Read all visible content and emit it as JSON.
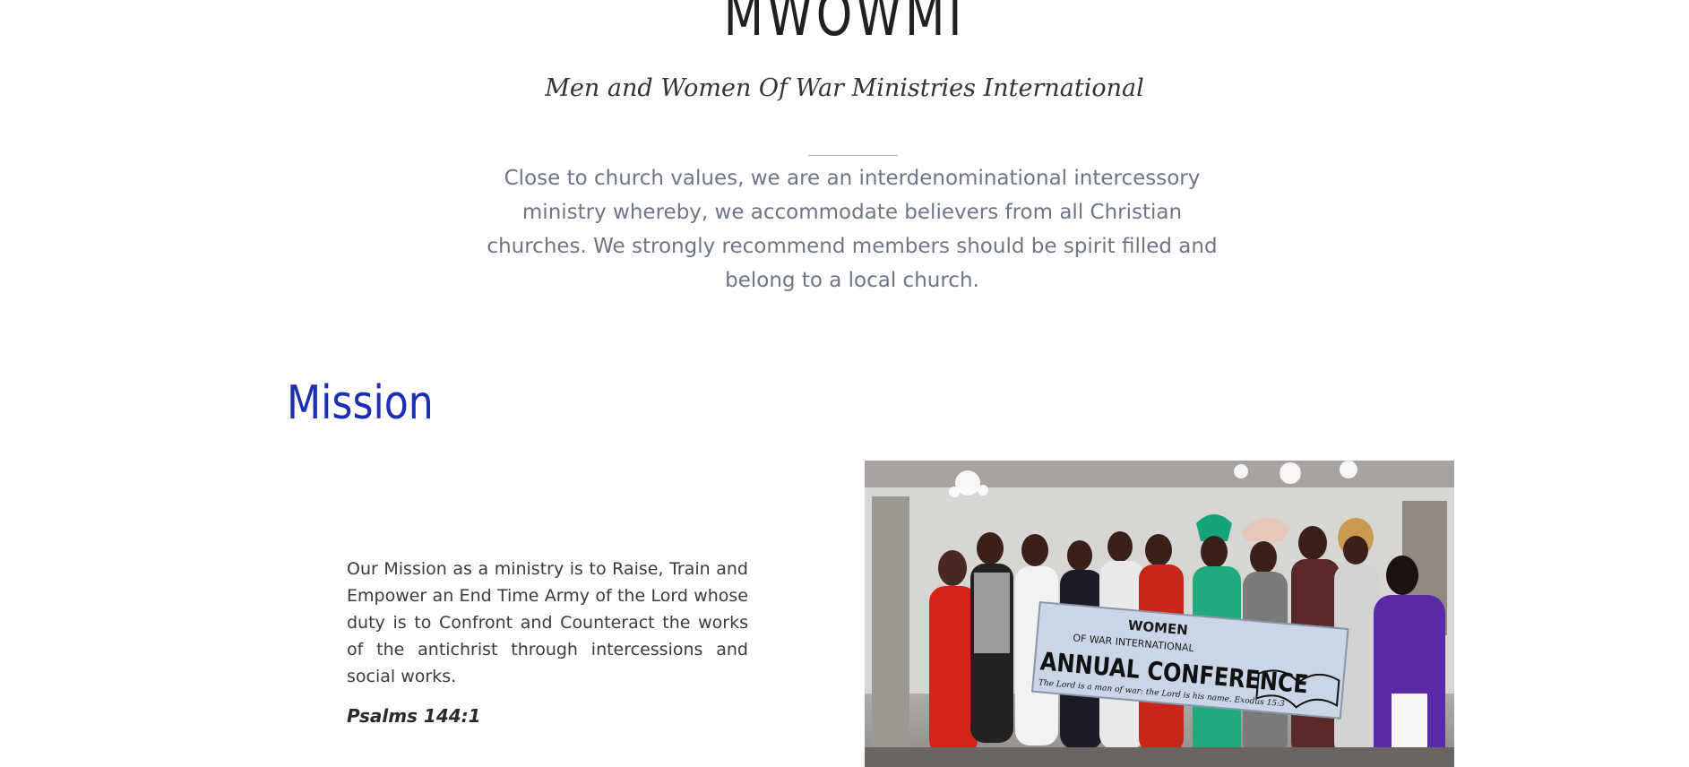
{
  "header": {
    "title": "MWOWMI",
    "subtitle": "Men and Women Of War Ministries International"
  },
  "intro": {
    "text": "Close to church values, we are an interdenominational intercessory ministry whereby, we accommodate believers from all Christian churches. We strongly recommend members should be spirit filled and belong to a local church."
  },
  "mission": {
    "heading": "Mission",
    "body": "Our Mission as a ministry is to Raise, Train and Empower an End Time Army of the Lord whose duty is to Confront and Counteract the works of the antichrist through intercessions and social works.",
    "scripture": "Psalms 144:1"
  },
  "photo": {
    "banner_line1": "WOMEN",
    "banner_line2": "OF WAR INTERNATIONAL",
    "banner_line3": "ANNUAL CONFERENCE",
    "banner_verse": "The Lord is a man of war: the Lord is his name.  Exodus 15:3"
  },
  "colors": {
    "heading_blue": "#1a2fb5",
    "intro_gray": "#6d7685",
    "divider": "#9fb0de"
  }
}
